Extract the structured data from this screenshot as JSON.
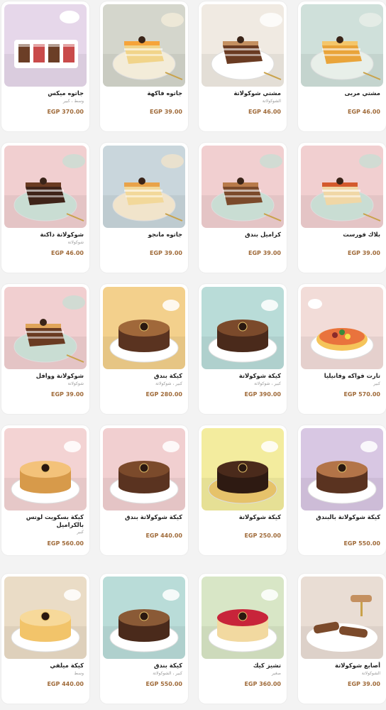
{
  "products": [
    {
      "title": "مشتي مربى",
      "subtitle": "",
      "price": "EGP 46.00",
      "bg": "#cfe0da",
      "plate": "#e8efe9",
      "cake": "#e9a43a",
      "top": "#f4c66a",
      "image": "cake-slice"
    },
    {
      "title": "مشتي شوكولاتة",
      "subtitle": "الشوكولاتة",
      "price": "EGP 46.00",
      "bg": "#f0eae2",
      "plate": "#ffffff",
      "cake": "#6a3b22",
      "top": "#c49060",
      "image": "cake-slice"
    },
    {
      "title": "جاتوه فاكهة",
      "subtitle": "",
      "price": "EGP 39.00",
      "bg": "#d4d6cc",
      "plate": "#f3ecd9",
      "cake": "#f1d48a",
      "top": "#f6a43a",
      "image": "cake-slice"
    },
    {
      "title": "جاتوه ميكس",
      "subtitle": "وسط ، كبير",
      "price": "EGP 370.00",
      "bg": "#e6d7ea",
      "plate": "#ffffff",
      "cake": "#c94a4a",
      "top": "#6b3e26",
      "image": "assorted"
    },
    {
      "title": "بلاك فورست",
      "subtitle": "",
      "price": "EGP 39.00",
      "bg": "#f1cfd0",
      "plate": "#c9ddd3",
      "cake": "#f0d7a6",
      "top": "#d45a2d",
      "image": "cake-slice"
    },
    {
      "title": "كراميل بندق",
      "subtitle": "",
      "price": "EGP 39.00",
      "bg": "#f1cfd0",
      "plate": "#c9ddd3",
      "cake": "#7b4a2b",
      "top": "#b87a4a",
      "image": "cake-slice"
    },
    {
      "title": "جاتوه مانجو",
      "subtitle": "",
      "price": "EGP 39.00",
      "bg": "#c9d6dc",
      "plate": "#f1e4cb",
      "cake": "#f2d89a",
      "top": "#e8a34a",
      "image": "cake-slice"
    },
    {
      "title": "شوكولاتة داكنة",
      "subtitle": "شوكولاتة",
      "price": "EGP 46.00",
      "bg": "#f1cfd0",
      "plate": "#c9ddd3",
      "cake": "#3f2419",
      "top": "#6a3b22",
      "image": "cake-slice"
    },
    {
      "title": "تارت فواكه وفانيليا",
      "subtitle": "كبير",
      "price": "EGP 570.00",
      "bg": "#f2dcd8",
      "plate": "#ffffff",
      "cake": "#f5c45a",
      "top": "#e86a3a",
      "image": "tart"
    },
    {
      "title": "كيكة شوكولاتة",
      "subtitle": "كبير ، شوكولاتة",
      "price": "EGP 390.00",
      "bg": "#b9dcd8",
      "plate": "#ffffff",
      "cake": "#4a2a1b",
      "top": "#7b4a2b",
      "image": "round-cake"
    },
    {
      "title": "كيكة بندق",
      "subtitle": "كبير ، شوكولاتة",
      "price": "EGP 280.00",
      "bg": "#f3d08c",
      "plate": "#ffffff",
      "cake": "#5a3320",
      "top": "#a0683a",
      "image": "round-cake"
    },
    {
      "title": "شوكولاتة ووافل",
      "subtitle": "شوكولاتة",
      "price": "EGP 39.00",
      "bg": "#f1cfd0",
      "plate": "#c9ddd3",
      "cake": "#6a3b22",
      "top": "#e0a55a",
      "image": "cake-slice"
    },
    {
      "title": "كيكة شوكولاتة بالبندق",
      "subtitle": "",
      "price": "EGP 550.00",
      "bg": "#d8c7e3",
      "plate": "#ffffff",
      "cake": "#5a3320",
      "top": "#b37448",
      "image": "round-cake"
    },
    {
      "title": "كيكة شوكولاتة",
      "subtitle": "",
      "price": "EGP 250.00",
      "bg": "#f3ec9e",
      "plate": "#e6c26a",
      "cake": "#2e1a12",
      "top": "#4a2a1b",
      "image": "round-cake"
    },
    {
      "title": "كيكة شوكولاتة بندق",
      "subtitle": "",
      "price": "EGP 440.00",
      "bg": "#f1cfd0",
      "plate": "#ffffff",
      "cake": "#5a3320",
      "top": "#7b4a2b",
      "image": "round-cake"
    },
    {
      "title": "كيكة بسكويت لوتس بالكراميل",
      "subtitle": "كبير",
      "price": "EGP 560.00",
      "bg": "#f3d3d3",
      "plate": "#ffffff",
      "cake": "#d79a4a",
      "top": "#f3c27a",
      "image": "round-cake"
    },
    {
      "title": "أصابع شوكولاتة",
      "subtitle": "الشوكولاتة",
      "price": "EGP 39.00",
      "bg": "#e9ddd4",
      "plate": "#ffffff",
      "cake": "#7b4a2b",
      "top": "#c49060",
      "image": "bars"
    },
    {
      "title": "تشيز كيك",
      "subtitle": "صغير",
      "price": "EGP 360.00",
      "bg": "#d8e6c6",
      "plate": "#ffffff",
      "cake": "#f2d9a0",
      "top": "#c8243a",
      "image": "round-cake"
    },
    {
      "title": "كيكة بندق",
      "subtitle": "كبير ، الشوكولاتة",
      "price": "EGP 550.00",
      "bg": "#b9dcd8",
      "plate": "#ffffff",
      "cake": "#4a2a1b",
      "top": "#8a5a36",
      "image": "round-cake"
    },
    {
      "title": "كيكة ميلفي",
      "subtitle": "وسط",
      "price": "EGP 440.00",
      "bg": "#eadcc6",
      "plate": "#ffffff",
      "cake": "#f2c46a",
      "top": "#f7d99a",
      "image": "round-cake"
    }
  ]
}
